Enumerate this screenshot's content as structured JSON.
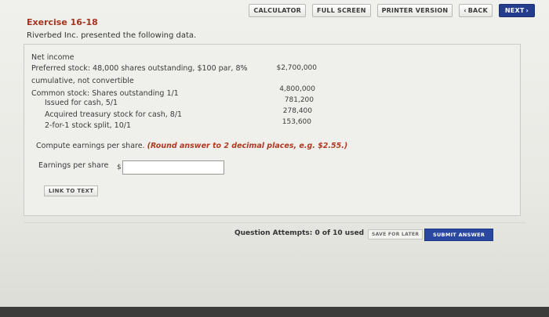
{
  "toolbar": {
    "calculator": "CALCULATOR",
    "full_screen": "FULL SCREEN",
    "printer_version": "PRINTER VERSION",
    "back": "BACK",
    "next": "NEXT"
  },
  "exercise": {
    "title": "Exercise 16-18",
    "intro": "Riverbed Inc. presented the following data."
  },
  "data_rows": [
    {
      "label": "Net income",
      "amount": ""
    },
    {
      "label": "Preferred stock: 48,000 shares outstanding, $100 par, 8%",
      "amount": "$2,700,000"
    },
    {
      "label": "cumulative, not convertible",
      "amount": ""
    },
    {
      "label": "Common stock: Shares outstanding 1/1",
      "amount": "4,800,000"
    },
    {
      "label": "Issued for cash, 5/1",
      "amount": "781,200"
    },
    {
      "label": "Acquired treasury stock for cash, 8/1",
      "amount": "278,400"
    },
    {
      "label": "2-for-1 stock split, 10/1",
      "amount": "153,600"
    }
  ],
  "question": {
    "text": "Compute earnings per share.",
    "hint": "(Round answer to 2 decimal places, e.g. $2.55.)"
  },
  "eps": {
    "label": "Earnings per share",
    "currency": "$",
    "value": ""
  },
  "link_to_text": "LINK TO TEXT",
  "footer": {
    "attempts": "Question Attempts: 0 of 10 used",
    "save_later": "SAVE FOR LATER",
    "submit": "SUBMIT ANSWER"
  }
}
